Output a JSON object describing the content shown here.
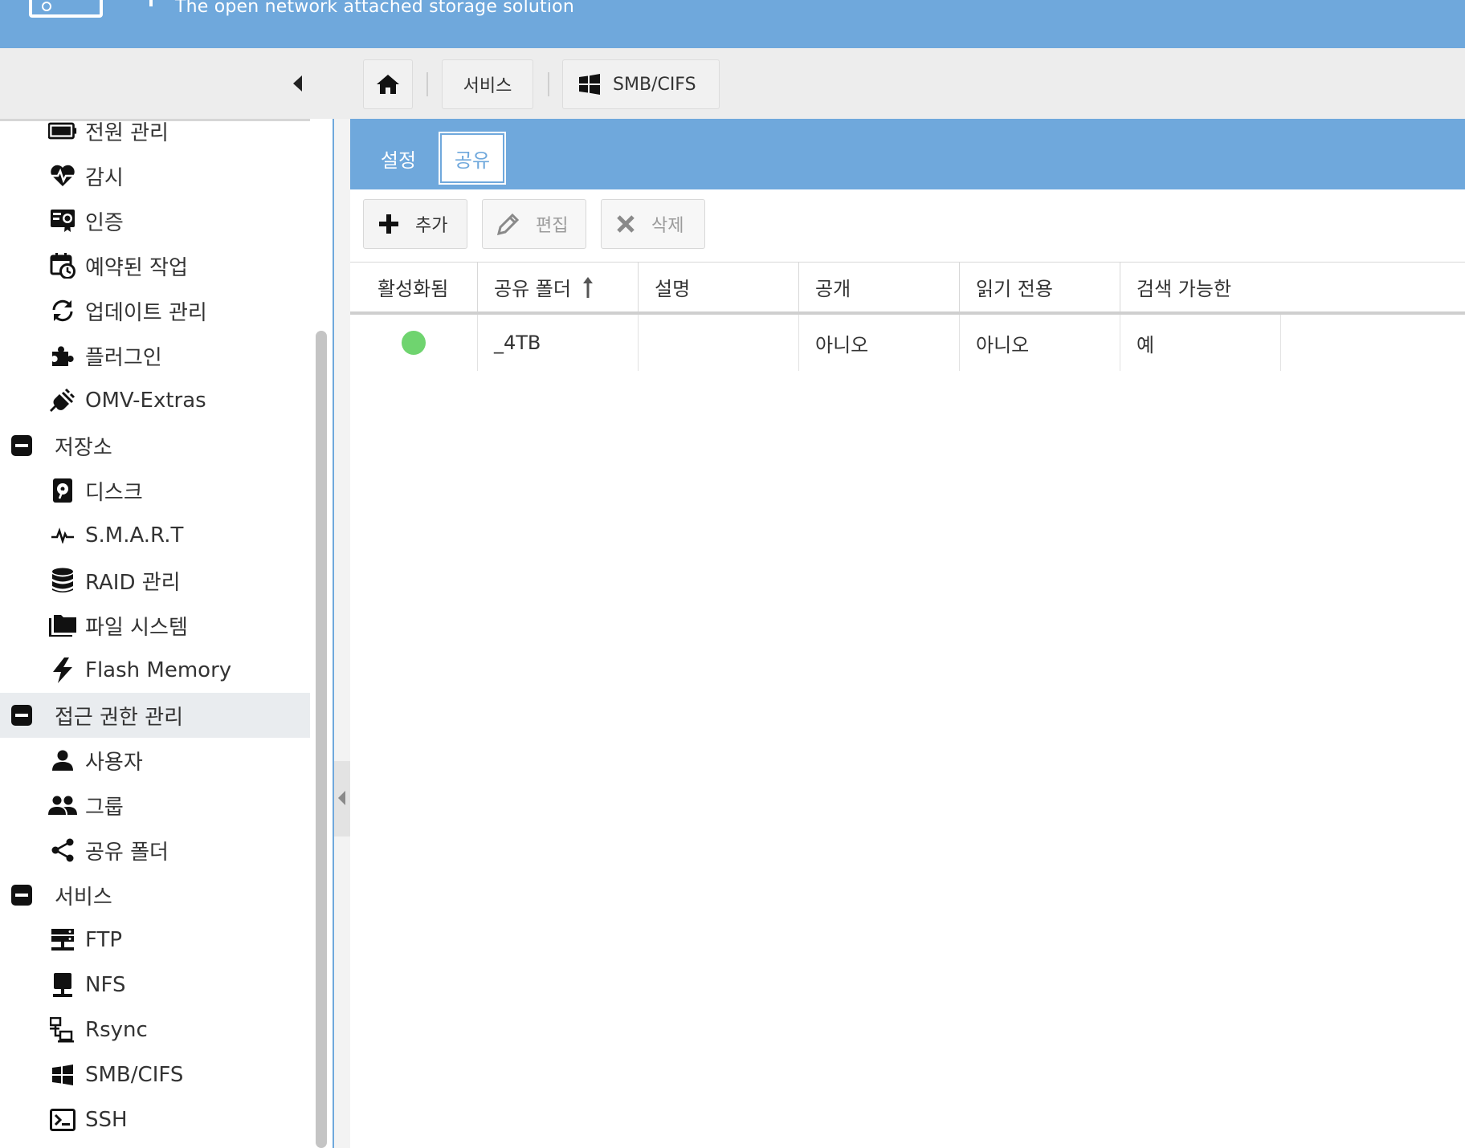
{
  "header": {
    "tagline": "The open network attached storage solution"
  },
  "breadcrumb": {
    "service": "서비스",
    "current": "SMB/CIFS"
  },
  "sidebar": {
    "items": [
      {
        "label": "전원 관리",
        "icon": "battery-icon",
        "type": "child"
      },
      {
        "label": "감시",
        "icon": "heartbeat-icon",
        "type": "child"
      },
      {
        "label": "인증",
        "icon": "certificate-icon",
        "type": "child"
      },
      {
        "label": "예약된 작업",
        "icon": "calendar-clock-icon",
        "type": "child"
      },
      {
        "label": "업데이트 관리",
        "icon": "refresh-icon",
        "type": "child"
      },
      {
        "label": "플러그인",
        "icon": "puzzle-icon",
        "type": "child"
      },
      {
        "label": "OMV-Extras",
        "icon": "plug-icon",
        "type": "child"
      },
      {
        "label": "저장소",
        "icon": "minus-box-icon",
        "type": "group"
      },
      {
        "label": "디스크",
        "icon": "disk-icon",
        "type": "child"
      },
      {
        "label": "S.M.A.R.T",
        "icon": "pulse-icon",
        "type": "child"
      },
      {
        "label": "RAID 관리",
        "icon": "database-icon",
        "type": "child"
      },
      {
        "label": "파일 시스템",
        "icon": "folders-icon",
        "type": "child"
      },
      {
        "label": "Flash Memory",
        "icon": "flash-icon",
        "type": "child"
      },
      {
        "label": "접근 권한 관리",
        "icon": "minus-box-icon",
        "type": "group"
      },
      {
        "label": "사용자",
        "icon": "user-icon",
        "type": "child"
      },
      {
        "label": "그룹",
        "icon": "users-icon",
        "type": "child"
      },
      {
        "label": "공유 폴더",
        "icon": "share-icon",
        "type": "child"
      },
      {
        "label": "서비스",
        "icon": "minus-box-icon",
        "type": "group"
      },
      {
        "label": "FTP",
        "icon": "server-icon",
        "type": "child"
      },
      {
        "label": "NFS",
        "icon": "network-disk-icon",
        "type": "child"
      },
      {
        "label": "Rsync",
        "icon": "sync-network-icon",
        "type": "child"
      },
      {
        "label": "SMB/CIFS",
        "icon": "windows-icon",
        "type": "child"
      },
      {
        "label": "SSH",
        "icon": "terminal-icon",
        "type": "child"
      }
    ]
  },
  "tabs": {
    "settings": "설정",
    "shares": "공유"
  },
  "actions": {
    "add": "추가",
    "edit": "편집",
    "delete": "삭제"
  },
  "grid": {
    "columns": [
      "활성화됨",
      "공유 폴더",
      "설명",
      "공개",
      "읽기 전용",
      "검색 가능한"
    ],
    "rows": [
      {
        "enabled": true,
        "shared_folder": "_4TB",
        "comment": "",
        "public": "아니오",
        "readonly": "아니오",
        "browseable": "예"
      }
    ]
  },
  "colors": {
    "accent": "#6fa8dc",
    "enabled_dot": "#6fd46f"
  }
}
